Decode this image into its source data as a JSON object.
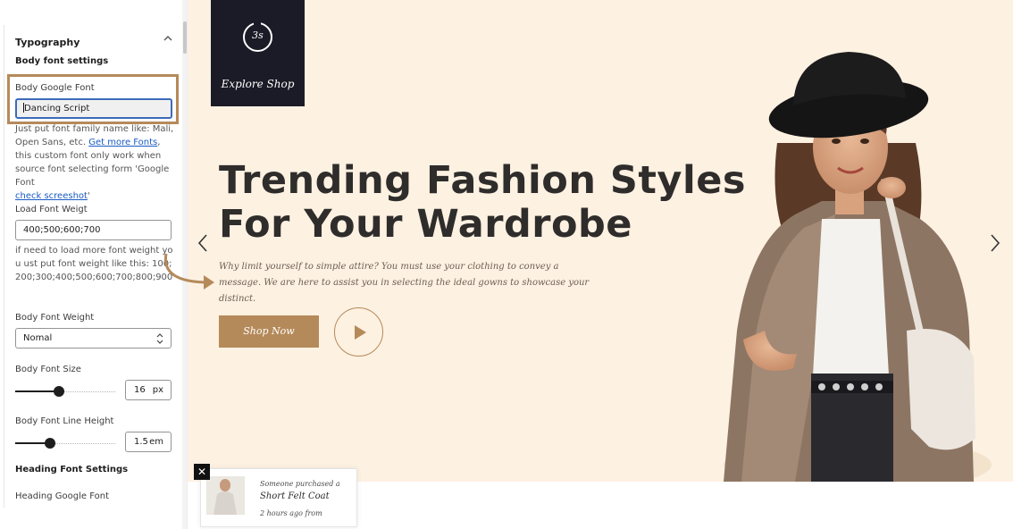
{
  "sidebar": {
    "section_title": "Typography",
    "body_settings_title": "Body font settings",
    "google_font": {
      "label": "Body Google Font",
      "value": "Dancing Script",
      "help_before": "Just put font family name like: Mali, Open Sans, etc. ",
      "help_link": "Get more Fonts",
      "help_after": ", this custom font only work when source font selecting form 'Google Font",
      "help_link2": "check screeshot",
      "help_end": "'"
    },
    "font_weight_load": {
      "label": "Load Font Weigt",
      "value": "400;500;600;700",
      "help": "if need to load more font weight you ust put font weight like this: 100;200;300;400;500;600;700;800;900"
    },
    "body_font_weight": {
      "label": "Body Font Weight",
      "value": "Nomal"
    },
    "body_font_size": {
      "label": "Body Font Size",
      "value": "16",
      "unit": "px",
      "slider_fraction": 0.44
    },
    "body_line_height": {
      "label": "Body Font Line Height",
      "value": "1.5",
      "unit": "em",
      "slider_fraction": 0.35
    },
    "heading_settings_title": "Heading Font Settings",
    "heading_google_font_label": "Heading Google Font"
  },
  "hero": {
    "logo_mark": "3s",
    "logo_text": "Explore Shop",
    "headline_line1": "Trending Fashion Styles",
    "headline_line2": "For Your Wardrobe",
    "description": "Why limit yourself to simple attire? You must use your clothing to convey a message. We are here to assist you in selecting the ideal gowns to showcase your distinct.",
    "shop_button": "Shop Now",
    "colors": {
      "background": "#fdf1e2",
      "accent": "#b58a5a",
      "headline": "#2f2d2b",
      "logo_bg": "#1b1b27"
    }
  },
  "notification": {
    "close": "✕",
    "line1": "Someone purchased a",
    "product": "Short Felt Coat",
    "time": "2 hours ago  from"
  },
  "icons": [
    "chevron-up-icon",
    "updown-icon",
    "arrow-left-icon",
    "arrow-right-icon",
    "play-icon",
    "close-icon",
    "curved-arrow-icon"
  ]
}
